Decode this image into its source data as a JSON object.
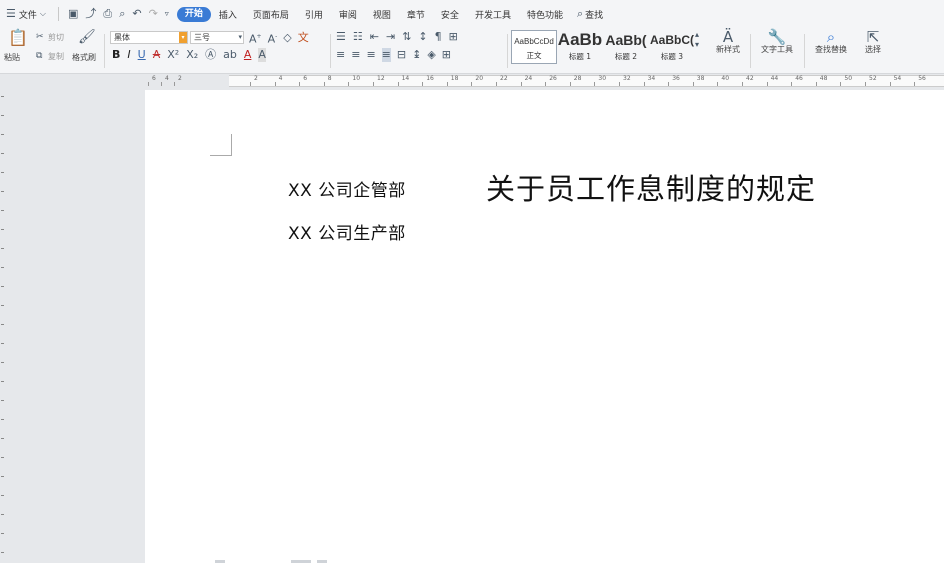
{
  "menu": {
    "file_label": "文件",
    "tabs": [
      "开始",
      "插入",
      "页面布局",
      "引用",
      "审阅",
      "视图",
      "章节",
      "安全",
      "开发工具",
      "特色功能"
    ],
    "active_tab": "开始",
    "search_label": "查找"
  },
  "ribbon": {
    "paste": "粘贴",
    "cut": "剪切",
    "copy": "复制",
    "format_painter": "格式刷",
    "font_name": "黑体",
    "font_size": "三号",
    "styles": [
      {
        "preview": "AaBbCcDd",
        "label": "正文"
      },
      {
        "preview": "AaBb",
        "label": "标题 1"
      },
      {
        "preview": "AaBb(",
        "label": "标题 2"
      },
      {
        "preview": "AaBbC(",
        "label": "标题 3"
      }
    ],
    "new_style": "新样式",
    "text_tools": "文字工具",
    "find_replace": "查找替换",
    "select": "选择"
  },
  "ruler": {
    "numbers": [
      "6",
      "4",
      "2",
      "2",
      "4",
      "6",
      "8",
      "10",
      "12",
      "14",
      "16",
      "18",
      "20",
      "22",
      "24",
      "26",
      "28",
      "30",
      "32",
      "34",
      "36",
      "38",
      "40",
      "42",
      "44",
      "46",
      "48",
      "50",
      "52",
      "54",
      "56"
    ]
  },
  "document": {
    "line1": "XX 公司企管部",
    "line2": "XX 公司生产部",
    "title": "关于员工作息制度的规定"
  }
}
